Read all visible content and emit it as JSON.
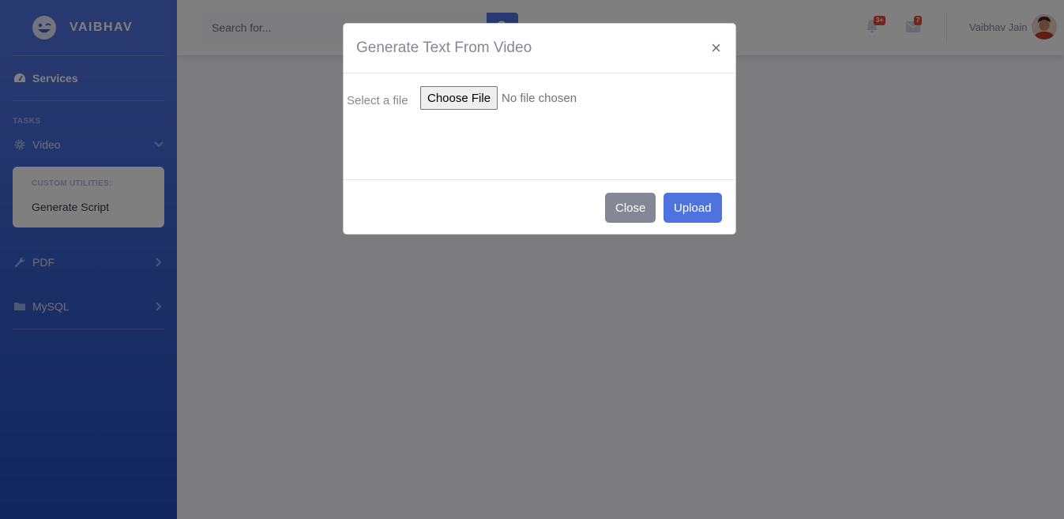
{
  "brand": {
    "name": "VAIBHAV",
    "icon": "laugh-wink-icon"
  },
  "sidebar": {
    "services_label": "Services",
    "heading": "TASKS",
    "items": [
      {
        "label": "Video",
        "icon": "cog-icon",
        "chevron": "chevron-down-icon"
      },
      {
        "label": "PDF",
        "icon": "wrench-icon",
        "chevron": "chevron-right-icon"
      },
      {
        "label": "MySQL",
        "icon": "folder-icon",
        "chevron": "chevron-right-icon"
      }
    ],
    "collapse": {
      "header": "CUSTOM UTILITIES:",
      "item": "Generate Script"
    }
  },
  "topbar": {
    "search_placeholder": "Search for...",
    "alerts_badge": "3+",
    "messages_badge": "7",
    "user_name": "Vaibhav Jain"
  },
  "modal": {
    "title": "Generate Text From Video",
    "close_symbol": "×",
    "file_label": "Select a file",
    "file_button": "Choose File",
    "file_status": "No file chosen",
    "close_button": "Close",
    "upload_button": "Upload"
  },
  "colors": {
    "primary": "#4e73df",
    "secondary": "#858796",
    "danger": "#e74a3b"
  }
}
